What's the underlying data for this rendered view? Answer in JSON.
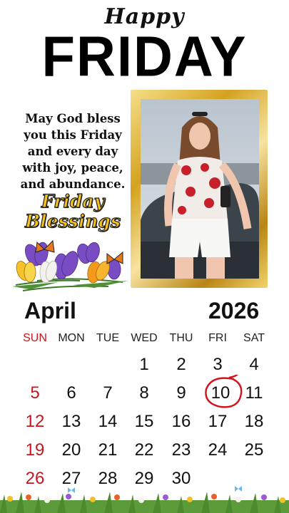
{
  "header": {
    "happy": "Happy",
    "day": "FRIDAY"
  },
  "message": {
    "lines": [
      "May God bless",
      "you this Friday",
      "and every day",
      "with joy, peace,",
      "and abundance."
    ],
    "friday_blessings": [
      "Friday",
      "Blessings"
    ]
  },
  "calendar": {
    "month": "April",
    "year": "2026",
    "weekdays": [
      "SUN",
      "MON",
      "TUE",
      "WED",
      "THU",
      "FRI",
      "SAT"
    ],
    "weeks": [
      [
        "",
        "",
        "",
        "1",
        "2",
        "3",
        "4"
      ],
      [
        "5",
        "6",
        "7",
        "8",
        "9",
        "10",
        "11"
      ],
      [
        "12",
        "13",
        "14",
        "15",
        "16",
        "17",
        "18"
      ],
      [
        "19",
        "20",
        "21",
        "22",
        "23",
        "24",
        "25"
      ],
      [
        "26",
        "27",
        "28",
        "29",
        "30",
        "",
        ""
      ]
    ],
    "highlighted_day": "10",
    "sunday_color": "#c9151e",
    "circle_color": "#d3121c"
  },
  "colors": {
    "gold_frame": "#d4a21f",
    "blessing_text": "#f4c21b"
  },
  "icons": [
    "crocus-flowers-bouquet",
    "monarch-butterfly",
    "flower-meadow-border"
  ]
}
